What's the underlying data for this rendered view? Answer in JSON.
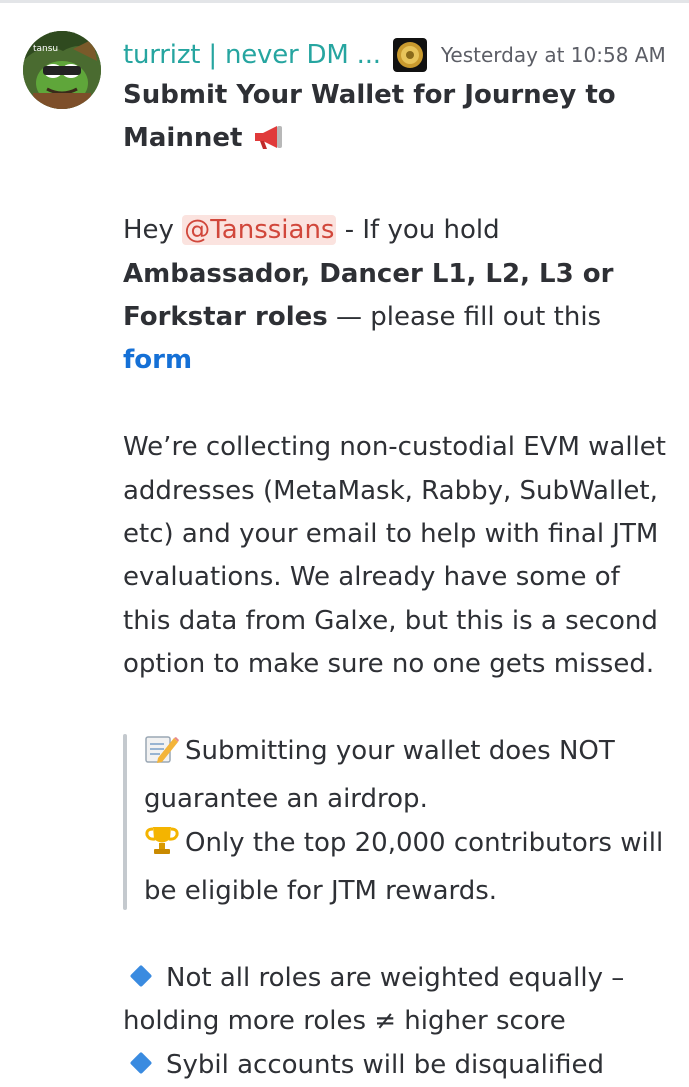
{
  "message": {
    "author": "turrizt | never DM ...",
    "timestamp": "Yesterday at 10:58 AM",
    "avatar_text": "tansu",
    "icons": {
      "avatar": "frog-avatar-icon",
      "role_badge": "gold-coin-badge-icon",
      "megaphone": "megaphone-emoji-icon",
      "memo": "memo-pencil-emoji-icon",
      "trophy": "trophy-emoji-icon",
      "diamond": "blue-diamond-emoji-icon"
    },
    "colors": {
      "username": "#26a5a0",
      "mention": "#d1473b",
      "mention_bg": "#fbe3df",
      "link": "#1570d6",
      "diamond": "#3a8be0"
    },
    "title": "Submit Your Wallet for Journey to Mainnet",
    "intro": {
      "hey": "Hey",
      "mention": "@Tanssians",
      "mid": "- If you hold",
      "roles": "Ambassador, Dancer L1, L2, L3 or Forkstar roles",
      "tail": "— please fill out this",
      "link": "form"
    },
    "body": "We’re collecting non-custodial EVM wallet addresses (MetaMask, Rabby, SubWallet, etc) and your email to help with final JTM evaluations. We already have some of this data from Galxe, but this is a second option to make sure no one gets missed.",
    "quote": {
      "line1": "Submitting your wallet does NOT guarantee an airdrop.",
      "line2": "Only the top 20,000 contributors will be eligible for JTM rewards."
    },
    "bullets": [
      "Not all roles are weighted equally – holding more roles ≠ higher score",
      "Sybil accounts will be disqualified"
    ]
  }
}
